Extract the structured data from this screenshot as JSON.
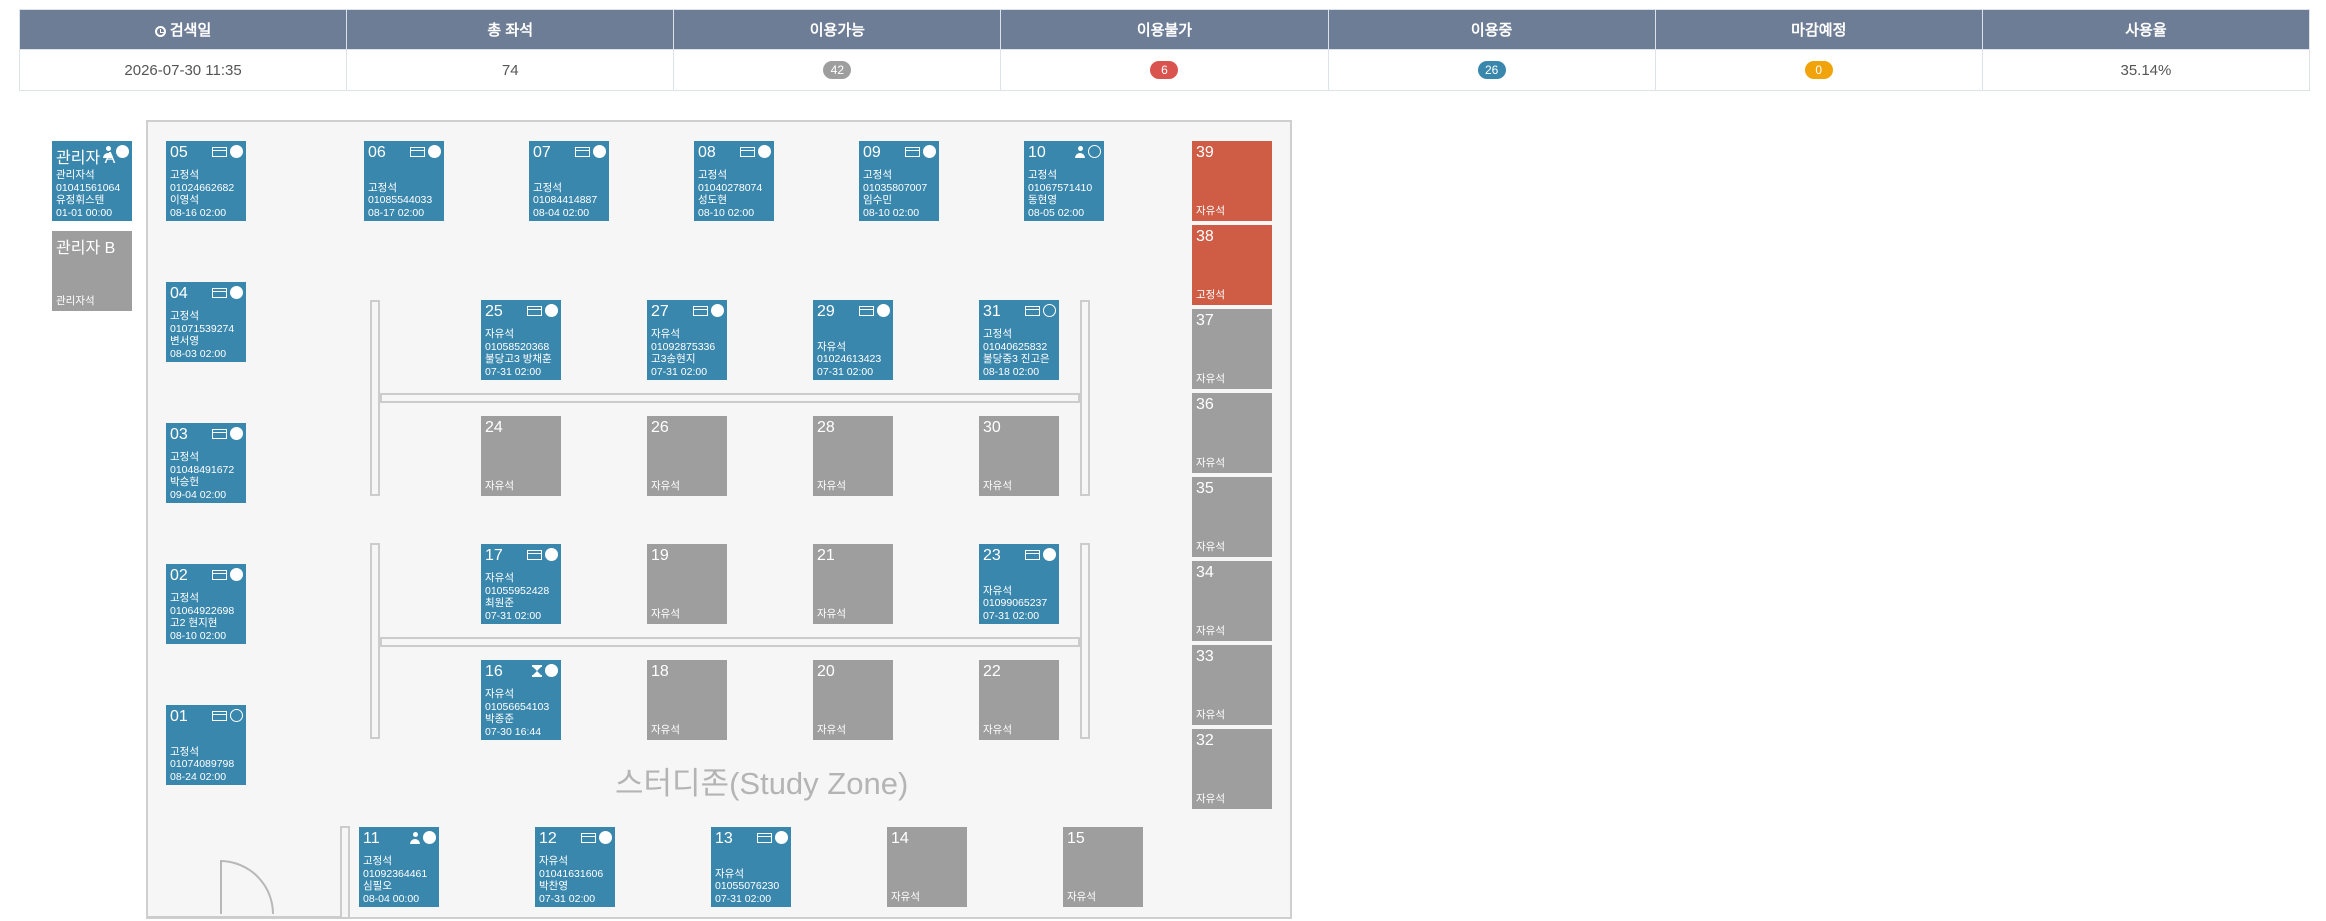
{
  "summary": {
    "headers": {
      "search_date": "검색일",
      "total_seats": "총 좌석",
      "available": "이용가능",
      "unavailable": "이용불가",
      "in_use": "이용중",
      "closing_soon": "마감예정",
      "usage_rate": "사용율"
    },
    "values": {
      "search_date": "2026-07-30 11:35",
      "total_seats": "74",
      "available": "42",
      "unavailable": "6",
      "in_use": "26",
      "closing_soon": "0",
      "usage_rate": "35.14%"
    },
    "colors": {
      "available": "#9e9e9e",
      "unavailable": "#d9534f",
      "in_use": "#3a87ad",
      "closing_soon": "#f0a30a"
    }
  },
  "zone_label": "스터디존(Study Zone)",
  "colors": {
    "in_use": "#3a87ad",
    "free": "#9e9e9e",
    "unavailable": "#cf5c45"
  },
  "admin_seats": [
    {
      "num": "관리자 A",
      "status": "in_use",
      "icons": [
        "person-icon",
        "filled-dot-icon"
      ],
      "lines": [
        "관리자석",
        "01041561064",
        "유정휘스텐",
        "01-01 00:00"
      ]
    },
    {
      "num": "관리자 B",
      "status": "free",
      "icons": [],
      "footer": "관리자석"
    }
  ],
  "seats": [
    {
      "num": "05",
      "status": "in_use",
      "icons": [
        "card-icon",
        "filled-dot-icon"
      ],
      "lines": [
        "고정석",
        "01024662682",
        "이영석",
        "08-16 02:00"
      ]
    },
    {
      "num": "04",
      "status": "in_use",
      "icons": [
        "card-icon",
        "filled-dot-icon"
      ],
      "lines": [
        "고정석",
        "01071539274",
        "변서영",
        "08-03 02:00"
      ]
    },
    {
      "num": "03",
      "status": "in_use",
      "icons": [
        "card-icon",
        "filled-dot-icon"
      ],
      "lines": [
        "고정석",
        "01048491672",
        "박승헌",
        "09-04 02:00"
      ]
    },
    {
      "num": "02",
      "status": "in_use",
      "icons": [
        "card-icon",
        "filled-dot-icon"
      ],
      "lines": [
        "고정석",
        "01064922698",
        "고2 현지현",
        "08-10 02:00"
      ]
    },
    {
      "num": "01",
      "status": "in_use",
      "icons": [
        "card-icon",
        "hollow-dot-icon"
      ],
      "lines": [
        "",
        "고정석",
        "01074089798",
        "08-24 02:00"
      ]
    },
    {
      "num": "06",
      "status": "in_use",
      "icons": [
        "card-icon",
        "filled-dot-icon"
      ],
      "lines": [
        "",
        "고정석",
        "01085544033",
        "08-17 02:00"
      ]
    },
    {
      "num": "07",
      "status": "in_use",
      "icons": [
        "card-icon",
        "filled-dot-icon"
      ],
      "lines": [
        "",
        "고정석",
        "01084414887",
        "08-04 02:00"
      ]
    },
    {
      "num": "08",
      "status": "in_use",
      "icons": [
        "card-icon",
        "filled-dot-icon"
      ],
      "lines": [
        "고정석",
        "01040278074",
        "성도현",
        "08-10 02:00"
      ]
    },
    {
      "num": "09",
      "status": "in_use",
      "icons": [
        "card-icon",
        "filled-dot-icon"
      ],
      "lines": [
        "고정석",
        "01035807007",
        "임수민",
        "08-10 02:00"
      ]
    },
    {
      "num": "10",
      "status": "in_use",
      "icons": [
        "person-icon",
        "hollow-dot-icon"
      ],
      "lines": [
        "고정석",
        "01067571410",
        "동현영",
        "08-05 02:00"
      ]
    },
    {
      "num": "25",
      "status": "in_use",
      "icons": [
        "card-icon",
        "filled-dot-icon"
      ],
      "lines": [
        "자유석",
        "01058520368",
        "불당고3 방채훈",
        "07-31 02:00"
      ]
    },
    {
      "num": "27",
      "status": "in_use",
      "icons": [
        "card-icon",
        "filled-dot-icon"
      ],
      "lines": [
        "자유석",
        "01092875336",
        "고3송현지",
        "07-31 02:00"
      ]
    },
    {
      "num": "29",
      "status": "in_use",
      "icons": [
        "card-icon",
        "filled-dot-icon"
      ],
      "lines": [
        "",
        "자유석",
        "01024613423",
        "07-31 02:00"
      ]
    },
    {
      "num": "31",
      "status": "in_use",
      "icons": [
        "card-icon",
        "hollow-dot-icon"
      ],
      "lines": [
        "고정석",
        "01040625832",
        "불당중3 진고은",
        "08-18 02:00"
      ]
    },
    {
      "num": "24",
      "status": "free",
      "icons": [],
      "footer": "자유석"
    },
    {
      "num": "26",
      "status": "free",
      "icons": [],
      "footer": "자유석"
    },
    {
      "num": "28",
      "status": "free",
      "icons": [],
      "footer": "자유석"
    },
    {
      "num": "30",
      "status": "free",
      "icons": [],
      "footer": "자유석"
    },
    {
      "num": "17",
      "status": "in_use",
      "icons": [
        "card-icon",
        "filled-dot-icon"
      ],
      "lines": [
        "자유석",
        "01055952428",
        "최원준",
        "07-31 02:00"
      ]
    },
    {
      "num": "19",
      "status": "free",
      "icons": [],
      "footer": "자유석"
    },
    {
      "num": "21",
      "status": "free",
      "icons": [],
      "footer": "자유석"
    },
    {
      "num": "23",
      "status": "in_use",
      "icons": [
        "card-icon",
        "filled-dot-icon"
      ],
      "lines": [
        "",
        "자유석",
        "01099065237",
        "07-31 02:00"
      ]
    },
    {
      "num": "16",
      "status": "in_use",
      "icons": [
        "hourglass-icon",
        "filled-dot-icon"
      ],
      "lines": [
        "자유석",
        "01056654103",
        "박종준",
        "07-30 16:44"
      ]
    },
    {
      "num": "18",
      "status": "free",
      "icons": [],
      "footer": "자유석"
    },
    {
      "num": "20",
      "status": "free",
      "icons": [],
      "footer": "자유석"
    },
    {
      "num": "22",
      "status": "free",
      "icons": [],
      "footer": "자유석"
    },
    {
      "num": "11",
      "status": "in_use",
      "icons": [
        "person-icon",
        "filled-dot-icon"
      ],
      "lines": [
        "고정석",
        "01092364461",
        "심필오",
        "08-04 00:00"
      ]
    },
    {
      "num": "12",
      "status": "in_use",
      "icons": [
        "card-icon",
        "filled-dot-icon"
      ],
      "lines": [
        "자유석",
        "01041631606",
        "박찬영",
        "07-31 02:00"
      ]
    },
    {
      "num": "13",
      "status": "in_use",
      "icons": [
        "card-icon",
        "filled-dot-icon"
      ],
      "lines": [
        "",
        "자유석",
        "01055076230",
        "07-31 02:00"
      ]
    },
    {
      "num": "14",
      "status": "free",
      "icons": [],
      "footer": "자유석"
    },
    {
      "num": "15",
      "status": "free",
      "icons": [],
      "footer": "자유석"
    },
    {
      "num": "39",
      "status": "unavailable",
      "icons": [],
      "footer": "자유석"
    },
    {
      "num": "38",
      "status": "unavailable",
      "icons": [],
      "footer": "고정석"
    },
    {
      "num": "37",
      "status": "free",
      "icons": [],
      "footer": "자유석"
    },
    {
      "num": "36",
      "status": "free",
      "icons": [],
      "footer": "자유석"
    },
    {
      "num": "35",
      "status": "free",
      "icons": [],
      "footer": "자유석"
    },
    {
      "num": "34",
      "status": "free",
      "icons": [],
      "footer": "자유석"
    },
    {
      "num": "33",
      "status": "free",
      "icons": [],
      "footer": "자유석"
    },
    {
      "num": "32",
      "status": "free",
      "icons": [],
      "footer": "자유석"
    }
  ]
}
